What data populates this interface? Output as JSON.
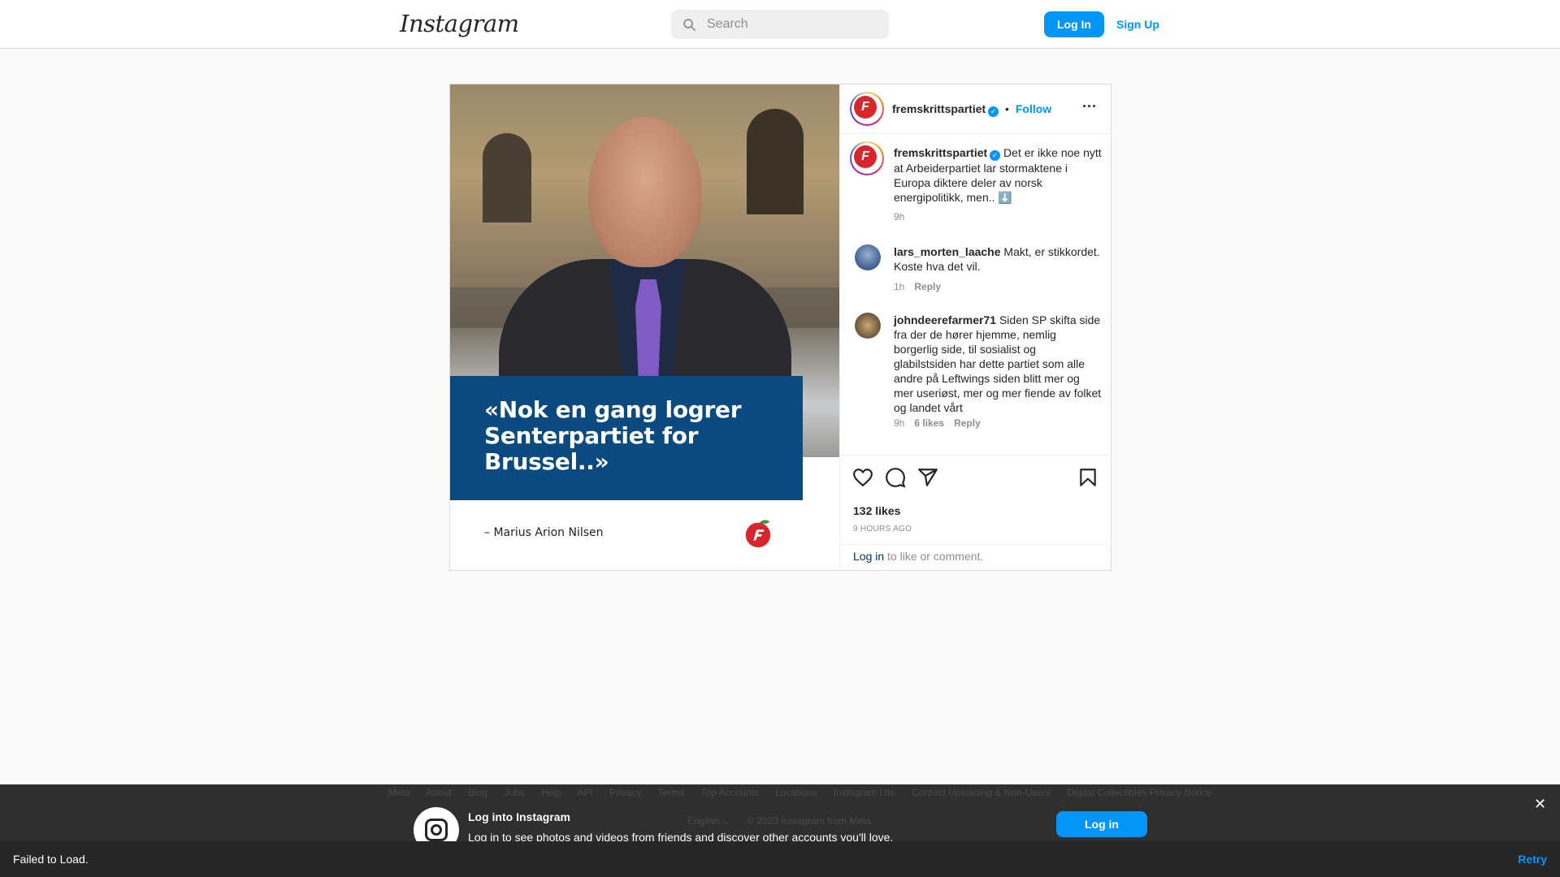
{
  "nav": {
    "logo": "Instagram",
    "search_placeholder": "Search",
    "login": "Log In",
    "signup": "Sign Up"
  },
  "post": {
    "username": "fremskrittspartiet",
    "follow": "Follow",
    "dot": "•",
    "image": {
      "quote": "«Nok en gang logrer Senterpartiet for Brussel..»",
      "author": "– Marius Arion Nilsen"
    },
    "caption": {
      "username": "fremskrittspartiet",
      "text": "Det er ikke noe nytt at Arbeiderpartiet lar stormaktene i Europa diktere deler av norsk energipolitikk, men.. ⬇️",
      "time": "9h"
    },
    "comments": [
      {
        "username": "lars_morten_laache",
        "text": "Makt, er stikkordet. Koste hva det vil.",
        "time": "1h",
        "likes": "",
        "reply": "Reply"
      },
      {
        "username": "johndeerefarmer71",
        "text": "Siden SP skifta side fra der de hører hjemme, nemlig borgerlig side, til sosialist og glabilstsiden har dette partiet som alle andre på Leftwings siden blitt mer og mer useriøst, mer og mer fiende av folket og landet vårt",
        "time": "9h",
        "likes": "6 likes",
        "reply": "Reply"
      }
    ],
    "likes": "132 likes",
    "ago": "9 HOURS AGO",
    "login_link": "Log in",
    "login_rest": " to like or comment."
  },
  "footer": {
    "links": [
      "Meta",
      "About",
      "Blog",
      "Jobs",
      "Help",
      "API",
      "Privacy",
      "Terms",
      "Top Accounts",
      "Locations",
      "Instagram Lite",
      "Contact Uploading & Non-Users",
      "Digital Collectibles Privacy Notice"
    ],
    "language": "English ⌵",
    "copyright": "© 2023 Instagram from Meta"
  },
  "overlay": {
    "title": "Log into Instagram",
    "subtitle": "Log in to see photos and videos from friends and discover other accounts you'll love.",
    "login": "Log in",
    "close": "✕"
  },
  "toast": {
    "message": "Failed to Load.",
    "retry": "Retry"
  },
  "colors": {
    "accent": "#0095f6",
    "quote_box": "#0a4a7f",
    "party_red": "#d7262c"
  }
}
